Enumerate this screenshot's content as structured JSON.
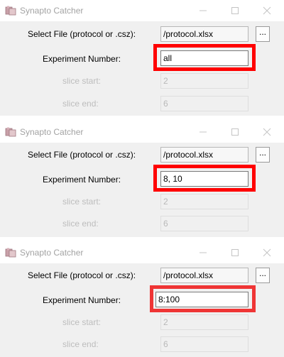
{
  "app_title": "Synapto Catcher",
  "labels": {
    "select_file": "Select File (protocol or .csz):",
    "experiment_number": "Experiment Number:",
    "slice_start": "slice start:",
    "slice_end": "slice end:"
  },
  "browse_label": "...",
  "colors": {
    "highlight": "#ff0000",
    "highlight_alt": "#ef3535"
  },
  "windows": [
    {
      "file_path": "/protocol.xlsx",
      "experiment_number": "all",
      "slice_start": "2",
      "slice_end": "6"
    },
    {
      "file_path": "/protocol.xlsx",
      "experiment_number": "8, 10",
      "slice_start": "2",
      "slice_end": "6"
    },
    {
      "file_path": "/protocol.xlsx",
      "experiment_number": "8:100",
      "slice_start": "2",
      "slice_end": "6"
    }
  ]
}
